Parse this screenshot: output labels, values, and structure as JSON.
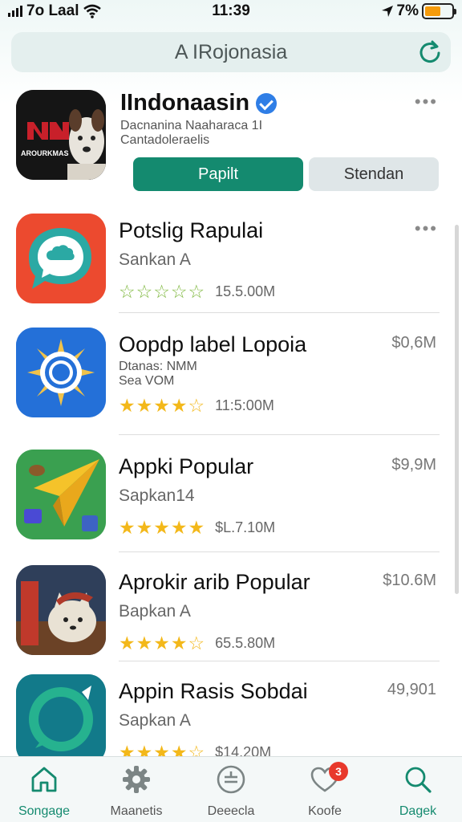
{
  "status_bar": {
    "carrier": "7o Laal",
    "time": "11:39",
    "battery": "7%",
    "battery_level": 0.6
  },
  "search": {
    "label": "A IRojonasia",
    "icon": "refresh-icon"
  },
  "featured": {
    "title": "IIndonaasin",
    "subtitle_line1": "Dacnanina Naaharaca 1I",
    "subtitle_line2": "Cantadoleraelis",
    "icon_text": "AROURKMAS",
    "primary_button": "Papilt",
    "secondary_button": "Stendan"
  },
  "apps": [
    {
      "title": "Potslig Rapulai",
      "sub": "Sankan A",
      "stars": "☆☆☆☆☆",
      "count": "15.5.00M",
      "price": ""
    },
    {
      "title": "Oopdp label Lopoia",
      "sub_line1": "Dtanas: NMM",
      "sub_line2": "Sea VOM",
      "stars": "★★★★☆",
      "count": "11:5:00M",
      "price": "$0,6M"
    },
    {
      "title": "Appki Popular",
      "sub": "Sapkan14",
      "stars": "★★★★★",
      "count": "$L.7.10M",
      "price": "$9,9M"
    },
    {
      "title": "Aprokir arib Popular",
      "sub": "Bapkan A",
      "stars": "★★★★☆",
      "count": "65.5.80M",
      "price": "$10.6M"
    },
    {
      "title": "Appin Rasis Sobdai",
      "sub": "Sapkan A",
      "stars": "★★★★☆",
      "count": "$14.20M",
      "price": "49,901"
    }
  ],
  "tabs": [
    {
      "label": "Songage",
      "icon": "home-icon",
      "active": true
    },
    {
      "label": "Maanetis",
      "icon": "gear-icon"
    },
    {
      "label": "Deeecla",
      "icon": "list-circle-icon"
    },
    {
      "label": "Koofe",
      "icon": "heart-icon",
      "badge": "3"
    },
    {
      "label": "Dagek",
      "icon": "search-icon"
    }
  ],
  "colors": {
    "accent": "#148a6f",
    "star": "#f3b81a",
    "badge": "#e8392c"
  }
}
